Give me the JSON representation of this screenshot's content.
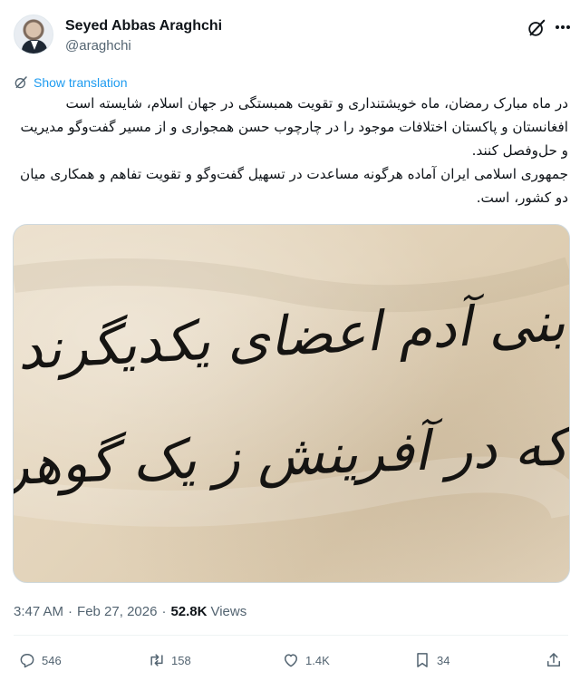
{
  "author": {
    "name": "Seyed Abbas Araghchi",
    "handle": "@araghchi"
  },
  "tweet": {
    "show_translation": "Show translation",
    "paragraphs": [
      "در ماه مبارک رمضان، ماه خویشتنداری و تقویت همبستگی در جهان اسلام، شایسته است افغانستان و پاکستان اختلافات موجود را در چارچوب حسن همجواری و از مسیر گفت‌وگو مدیریت و حل‌وفصل کنند.",
      "جمهوری اسلامی ایران آماده هرگونه مساعدت در تسهیل گفت‌وگو و تقویت تفاهم و همکاری میان دو کشور، است."
    ],
    "image_text": {
      "line1": "بنی آدم اعضای یکدیگرند",
      "line2": "که در آفرینش ز یک گوهرند"
    },
    "time": "3:47 AM",
    "date": "Feb 27, 2026",
    "views_count": "52.8K",
    "views_label": "Views"
  },
  "actions": {
    "replies": "546",
    "retweets": "158",
    "likes": "1.4K",
    "bookmarks": "34"
  },
  "icons": {
    "grok": "grok-icon",
    "more": "more-icon",
    "translate": "grok-translate-icon",
    "reply": "reply-icon",
    "retweet": "retweet-icon",
    "like": "heart-icon",
    "bookmark": "bookmark-icon",
    "share": "share-icon"
  },
  "colors": {
    "link": "#1d9bf0",
    "muted": "#536471",
    "text": "#0f1419"
  }
}
